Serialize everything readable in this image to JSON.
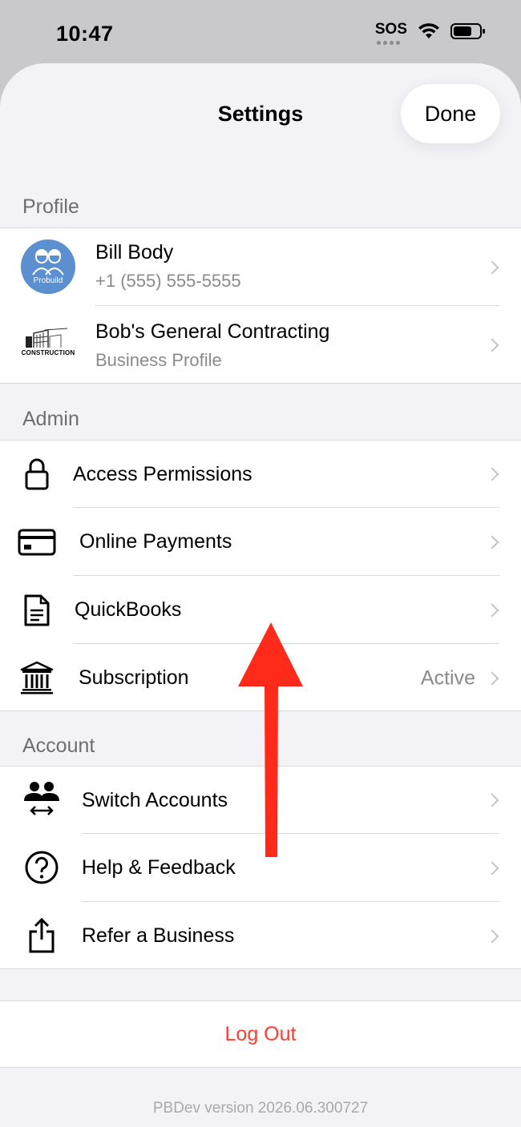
{
  "status_bar": {
    "time": "10:47",
    "sos": "SOS"
  },
  "nav": {
    "title": "Settings",
    "done_label": "Done"
  },
  "profile": {
    "header": "Profile",
    "user": {
      "name": "Bill Body",
      "phone": "+1 (555) 555-5555",
      "avatar_text": "Probuild"
    },
    "business": {
      "name": "Bob's General Contracting",
      "subtitle": "Business Profile",
      "logo_text": "CONSTRUCTION"
    }
  },
  "admin": {
    "header": "Admin",
    "items": [
      {
        "label": "Access Permissions",
        "icon": "lock-icon"
      },
      {
        "label": "Online Payments",
        "icon": "credit-card-icon"
      },
      {
        "label": "QuickBooks",
        "icon": "document-icon"
      },
      {
        "label": "Subscription",
        "icon": "bank-icon",
        "value": "Active"
      }
    ]
  },
  "account": {
    "header": "Account",
    "items": [
      {
        "label": "Switch Accounts",
        "icon": "switch-users-icon"
      },
      {
        "label": "Help & Feedback",
        "icon": "question-circle-icon"
      },
      {
        "label": "Refer a Business",
        "icon": "share-icon"
      }
    ]
  },
  "logout_label": "Log Out",
  "version": "PBDev version 2026.06.300727",
  "colors": {
    "destructive": "#ff3b30",
    "annotation_arrow": "#ff2a1a",
    "avatar_bg": "#5b8fd0"
  }
}
